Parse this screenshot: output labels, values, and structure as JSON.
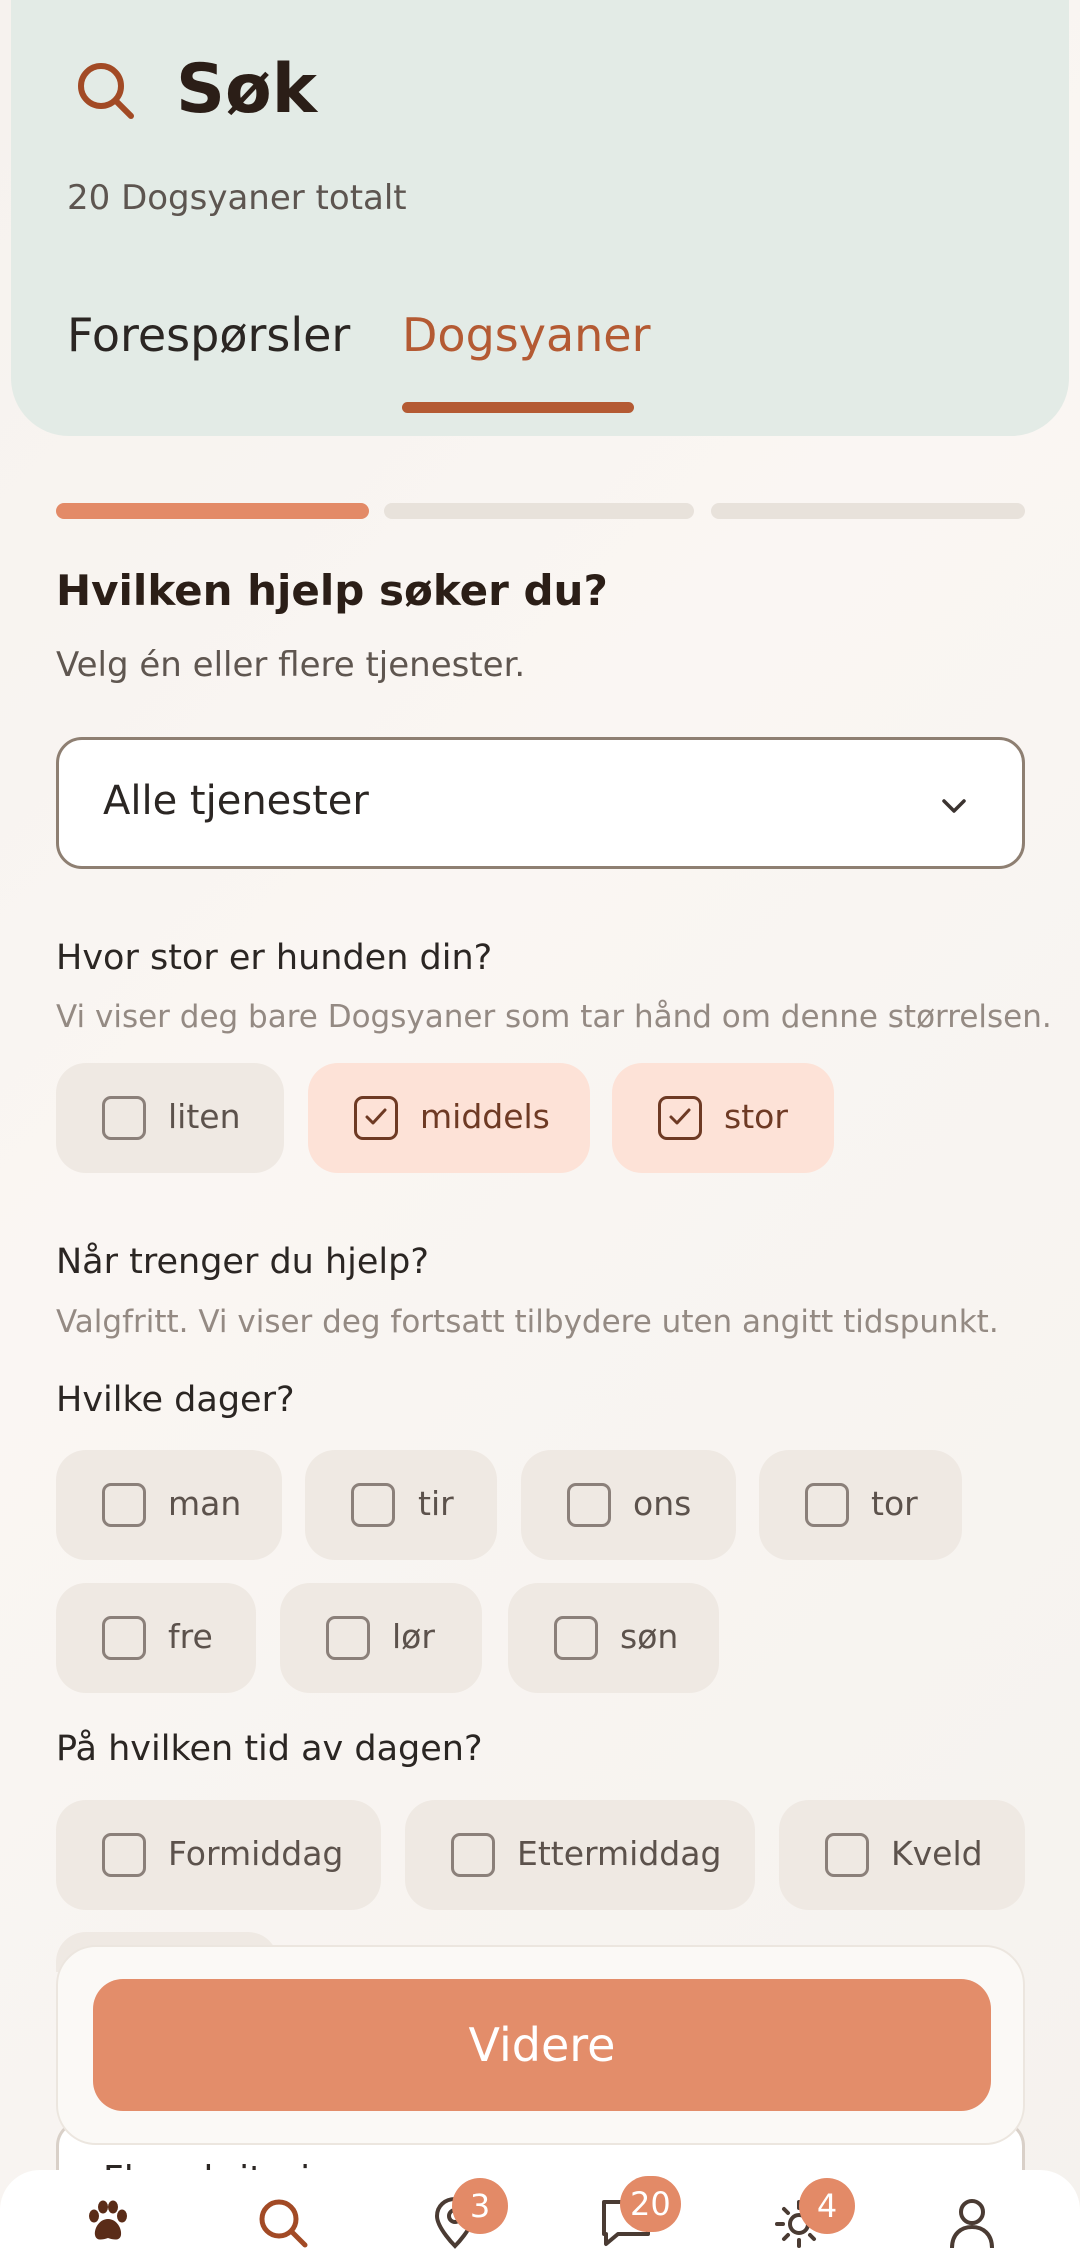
{
  "header": {
    "title": "Søk",
    "subtitle": "20 Dogsyaner totalt",
    "tabs": [
      {
        "label": "Forespørsler"
      },
      {
        "label": "Dogsyaner"
      }
    ]
  },
  "progress": {
    "step": 1,
    "total": 3
  },
  "question": {
    "title": "Hvilken hjelp søker du?",
    "subtitle": "Velg én eller flere tjenester."
  },
  "service_select": {
    "value": "Alle tjenester"
  },
  "size": {
    "title": "Hvor stor er hunden din?",
    "subtitle": "Vi viser deg bare Dogsyaner som tar hånd om denne størrelsen.",
    "options": [
      {
        "label": "liten",
        "checked": false
      },
      {
        "label": "middels",
        "checked": true
      },
      {
        "label": "stor",
        "checked": true
      }
    ]
  },
  "when": {
    "title": "Når trenger du hjelp?",
    "subtitle": "Valgfritt. Vi viser deg fortsatt tilbydere uten angitt tidspunkt."
  },
  "days": {
    "title": "Hvilke dager?",
    "options": [
      {
        "label": "man"
      },
      {
        "label": "tir"
      },
      {
        "label": "ons"
      },
      {
        "label": "tor"
      },
      {
        "label": "fre"
      },
      {
        "label": "lør"
      },
      {
        "label": "søn"
      }
    ]
  },
  "time": {
    "title": "På hvilken tid av dagen?",
    "options": [
      {
        "label": "Formiddag"
      },
      {
        "label": "Ettermiddag"
      },
      {
        "label": "Kveld"
      }
    ]
  },
  "next_button": "Videre",
  "more_criteria": "Flere kriterier",
  "nav": {
    "items": [
      {
        "icon": "paw-icon"
      },
      {
        "icon": "search-icon"
      },
      {
        "icon": "location-icon",
        "badge": "3"
      },
      {
        "icon": "chat-icon",
        "badge": "20"
      },
      {
        "icon": "sun-icon",
        "badge": "4"
      },
      {
        "icon": "profile-icon"
      }
    ]
  },
  "colors": {
    "accent": "#e38a67",
    "tab_active": "#b45a33",
    "header_bg": "#e3ebe6"
  }
}
